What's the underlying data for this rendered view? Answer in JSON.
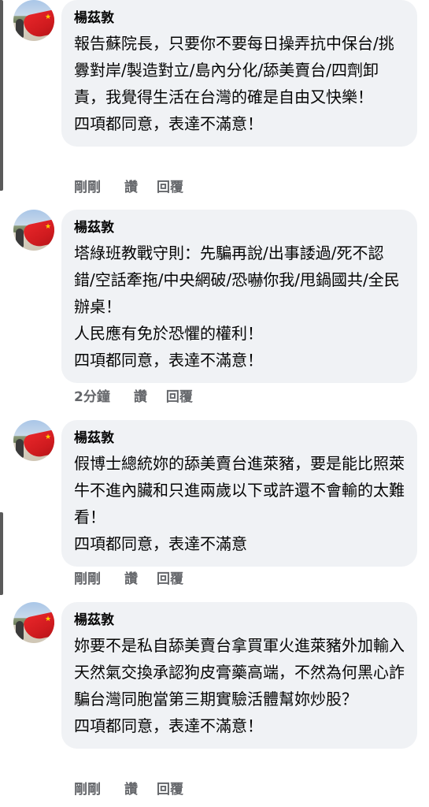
{
  "comments": [
    {
      "author": "楊茲敦",
      "text": "報告蘇院長，只要你不要每日操弄抗中保台/挑釁對岸/製造對立/島內分化/舔美賣台/四劑卸責，我覺得生活在台灣的確是自由又快樂！\n四項都同意，表達不滿意！",
      "time": "剛剛",
      "like": "讚",
      "reply": "回覆"
    },
    {
      "author": "楊茲敦",
      "text": "塔綠班教戰守則：先騙再說/出事諉過/死不認錯/空話牽拖/中央網破/恐嚇你我/甩鍋國共/全民辦桌！\n人民應有免於恐懼的權利！\n四項都同意，表達不滿意！",
      "time": "2分鐘",
      "like": "讚",
      "reply": "回覆"
    },
    {
      "author": "楊茲敦",
      "text": "假博士總統妳的舔美賣台進萊豬，要是能比照萊牛不進內臟和只進兩歲以下或許還不會輸的太難看！\n四項都同意，表達不滿意",
      "time": "剛剛",
      "like": "讚",
      "reply": "回覆"
    },
    {
      "author": "楊茲敦",
      "text": "妳要不是私自舔美賣台拿買軍火進萊豬外加輸入天然氣交換承認狗皮膏藥高端，不然為何黑心詐騙台灣同胞當第三期實驗活體幫妳炒股？\n四項都同意，表達不滿意！",
      "time": "剛剛",
      "like": "讚",
      "reply": "回覆"
    }
  ],
  "colors": {
    "bubble": "#f0f2f5",
    "text": "#050505",
    "meta": "#65676b"
  }
}
